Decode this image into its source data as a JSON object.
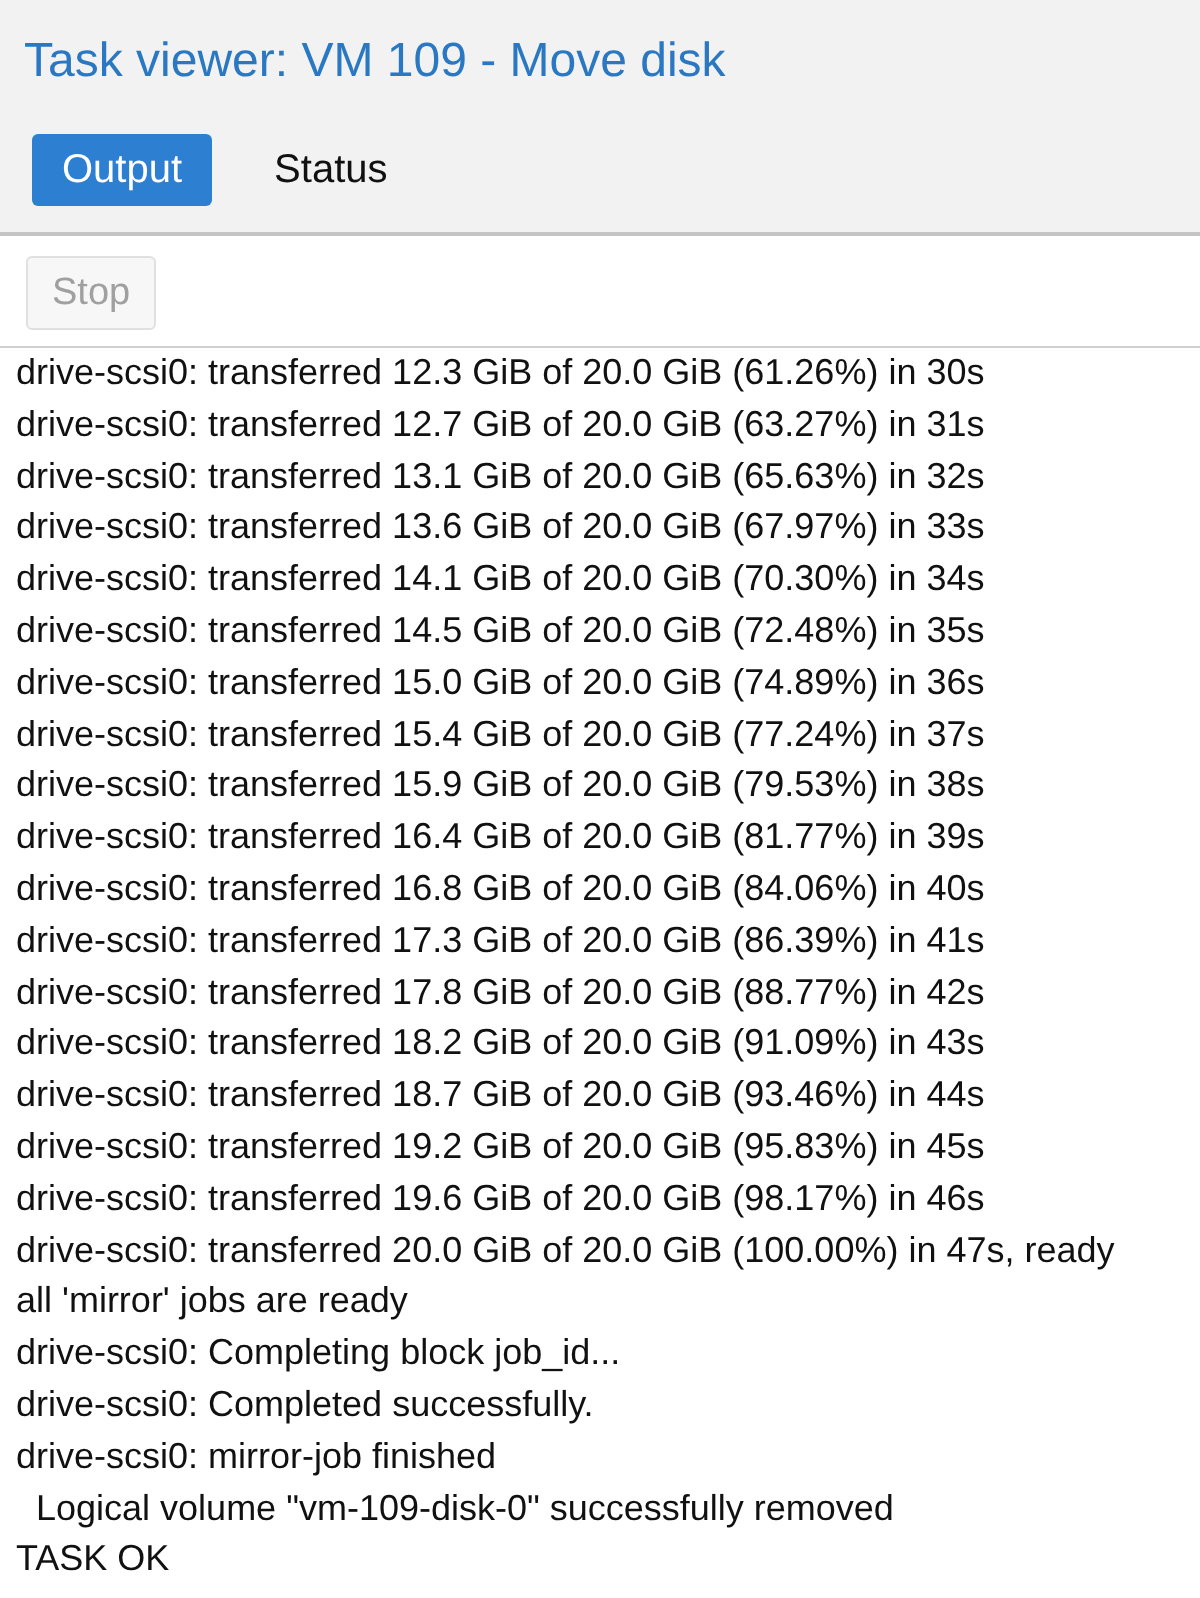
{
  "window": {
    "title": "Task viewer: VM 109 - Move disk"
  },
  "tabs": [
    {
      "label": "Output",
      "selected": true
    },
    {
      "label": "Status",
      "selected": false
    }
  ],
  "toolbar": {
    "buttons": [
      {
        "label": "Stop",
        "disabled": true
      }
    ]
  },
  "output": {
    "lines": [
      "drive-scsi0: transferred 12.3 GiB of 20.0 GiB (61.26%) in 30s",
      "drive-scsi0: transferred 12.7 GiB of 20.0 GiB (63.27%) in 31s",
      "drive-scsi0: transferred 13.1 GiB of 20.0 GiB (65.63%) in 32s",
      "drive-scsi0: transferred 13.6 GiB of 20.0 GiB (67.97%) in 33s",
      "drive-scsi0: transferred 14.1 GiB of 20.0 GiB (70.30%) in 34s",
      "drive-scsi0: transferred 14.5 GiB of 20.0 GiB (72.48%) in 35s",
      "drive-scsi0: transferred 15.0 GiB of 20.0 GiB (74.89%) in 36s",
      "drive-scsi0: transferred 15.4 GiB of 20.0 GiB (77.24%) in 37s",
      "drive-scsi0: transferred 15.9 GiB of 20.0 GiB (79.53%) in 38s",
      "drive-scsi0: transferred 16.4 GiB of 20.0 GiB (81.77%) in 39s",
      "drive-scsi0: transferred 16.8 GiB of 20.0 GiB (84.06%) in 40s",
      "drive-scsi0: transferred 17.3 GiB of 20.0 GiB (86.39%) in 41s",
      "drive-scsi0: transferred 17.8 GiB of 20.0 GiB (88.77%) in 42s",
      "drive-scsi0: transferred 18.2 GiB of 20.0 GiB (91.09%) in 43s",
      "drive-scsi0: transferred 18.7 GiB of 20.0 GiB (93.46%) in 44s",
      "drive-scsi0: transferred 19.2 GiB of 20.0 GiB (95.83%) in 45s",
      "drive-scsi0: transferred 19.6 GiB of 20.0 GiB (98.17%) in 46s",
      "drive-scsi0: transferred 20.0 GiB of 20.0 GiB (100.00%) in 47s, ready",
      "all 'mirror' jobs are ready",
      "drive-scsi0: Completing block job_id...",
      "drive-scsi0: Completed successfully.",
      "drive-scsi0: mirror-job finished",
      "  Logical volume \"vm-109-disk-0\" successfully removed",
      "TASK OK"
    ]
  }
}
